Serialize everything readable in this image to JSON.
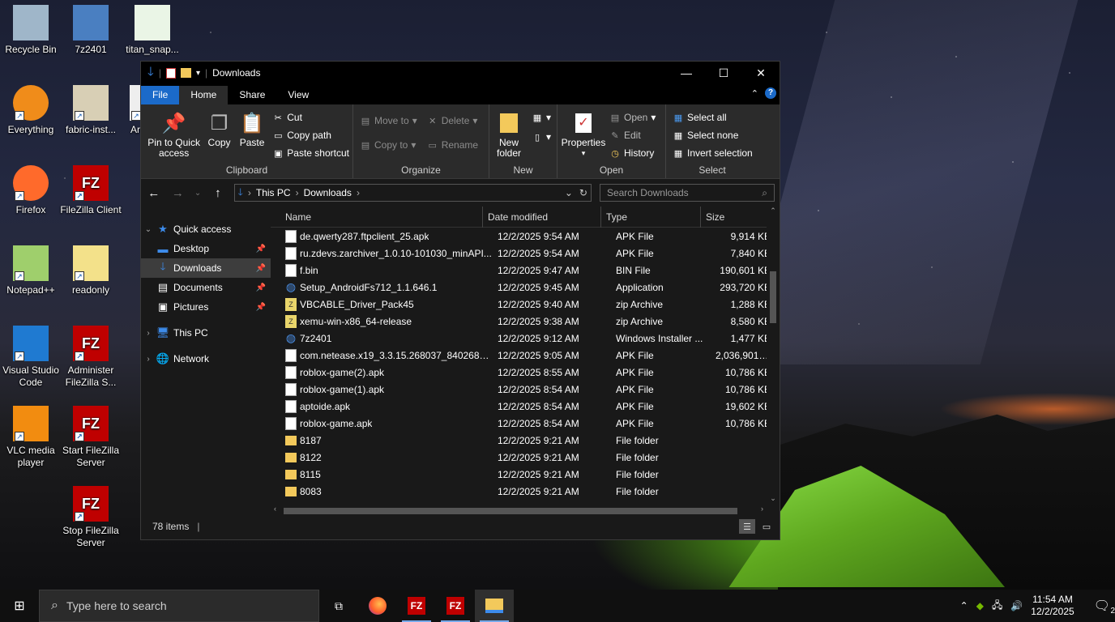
{
  "desktop": {
    "icons": [
      {
        "label": "Recycle Bin"
      },
      {
        "label": "7z2401"
      },
      {
        "label": "titan_snap..."
      },
      {
        "label": "Everything"
      },
      {
        "label": "fabric-inst..."
      },
      {
        "label": "Ar"
      },
      {
        "label": "Firefox"
      },
      {
        "label": "FileZilla Client"
      },
      {
        "label": "Notepad++"
      },
      {
        "label": "readonly"
      },
      {
        "label": "Visual Studio Code"
      },
      {
        "label": "Administer FileZilla S..."
      },
      {
        "label": "VLC media player"
      },
      {
        "label": "Start FileZilla Server"
      },
      {
        "label": "Stop FileZilla Server"
      }
    ]
  },
  "window": {
    "title": "Downloads",
    "controls": {
      "minimize": "—",
      "maximize": "☐",
      "close": "✕"
    }
  },
  "tabs": [
    "File",
    "Home",
    "Share",
    "View"
  ],
  "ribbon": {
    "clipboard": {
      "label": "Clipboard",
      "pin": "Pin to Quick access",
      "copy": "Copy",
      "paste": "Paste",
      "cut": "Cut",
      "copy_path": "Copy path",
      "paste_shortcut": "Paste shortcut"
    },
    "organize": {
      "label": "Organize",
      "move_to": "Move to",
      "copy_to": "Copy to",
      "delete": "Delete",
      "rename": "Rename"
    },
    "new": {
      "label": "New",
      "new_folder": "New folder"
    },
    "open": {
      "label": "Open",
      "properties": "Properties",
      "open": "Open",
      "edit": "Edit",
      "history": "History"
    },
    "select": {
      "label": "Select",
      "select_all": "Select all",
      "select_none": "Select none",
      "invert": "Invert selection"
    }
  },
  "address": {
    "crumbs": [
      "This PC",
      "Downloads"
    ],
    "search_placeholder": "Search Downloads"
  },
  "navpane": {
    "quick_access": "Quick access",
    "desktop": "Desktop",
    "downloads": "Downloads",
    "documents": "Documents",
    "pictures": "Pictures",
    "this_pc": "This PC",
    "network": "Network"
  },
  "columns": {
    "name": "Name",
    "date": "Date modified",
    "type": "Type",
    "size": "Size"
  },
  "files": [
    {
      "name": "de.qwerty287.ftpclient_25.apk",
      "date": "12/2/2025 9:54 AM",
      "type": "APK File",
      "size": "9,914 KB",
      "icon": "doc"
    },
    {
      "name": "ru.zdevs.zarchiver_1.0.10-101030_minAPI...",
      "date": "12/2/2025 9:54 AM",
      "type": "APK File",
      "size": "7,840 KB",
      "icon": "doc"
    },
    {
      "name": "f.bin",
      "date": "12/2/2025 9:47 AM",
      "type": "BIN File",
      "size": "190,601 KB",
      "icon": "doc"
    },
    {
      "name": "Setup_AndroidFs712_1.1.646.1",
      "date": "12/2/2025 9:45 AM",
      "type": "Application",
      "size": "293,720 KB",
      "icon": "app"
    },
    {
      "name": "VBCABLE_Driver_Pack45",
      "date": "12/2/2025 9:40 AM",
      "type": "zip Archive",
      "size": "1,288 KB",
      "icon": "zip"
    },
    {
      "name": "xemu-win-x86_64-release",
      "date": "12/2/2025 9:38 AM",
      "type": "zip Archive",
      "size": "8,580 KB",
      "icon": "zip"
    },
    {
      "name": "7z2401",
      "date": "12/2/2025 9:12 AM",
      "type": "Windows Installer ...",
      "size": "1,477 KB",
      "icon": "app"
    },
    {
      "name": "com.netease.x19_3.3.15.268037_84026803...",
      "date": "12/2/2025 9:05 AM",
      "type": "APK File",
      "size": "2,036,901 KB",
      "icon": "doc"
    },
    {
      "name": "roblox-game(2).apk",
      "date": "12/2/2025 8:55 AM",
      "type": "APK File",
      "size": "10,786 KB",
      "icon": "doc"
    },
    {
      "name": "roblox-game(1).apk",
      "date": "12/2/2025 8:54 AM",
      "type": "APK File",
      "size": "10,786 KB",
      "icon": "doc"
    },
    {
      "name": "aptoide.apk",
      "date": "12/2/2025 8:54 AM",
      "type": "APK File",
      "size": "19,602 KB",
      "icon": "doc"
    },
    {
      "name": "roblox-game.apk",
      "date": "12/2/2025 8:54 AM",
      "type": "APK File",
      "size": "10,786 KB",
      "icon": "doc"
    },
    {
      "name": "8187",
      "date": "12/2/2025 9:21 AM",
      "type": "File folder",
      "size": "",
      "icon": "folder"
    },
    {
      "name": "8122",
      "date": "12/2/2025 9:21 AM",
      "type": "File folder",
      "size": "",
      "icon": "folder"
    },
    {
      "name": "8115",
      "date": "12/2/2025 9:21 AM",
      "type": "File folder",
      "size": "",
      "icon": "folder"
    },
    {
      "name": "8083",
      "date": "12/2/2025 9:21 AM",
      "type": "File folder",
      "size": "",
      "icon": "folder"
    }
  ],
  "status": {
    "count": "78 items"
  },
  "taskbar": {
    "search_placeholder": "Type here to search",
    "time": "11:54 AM",
    "date": "12/2/2025",
    "notification_count": "2"
  }
}
